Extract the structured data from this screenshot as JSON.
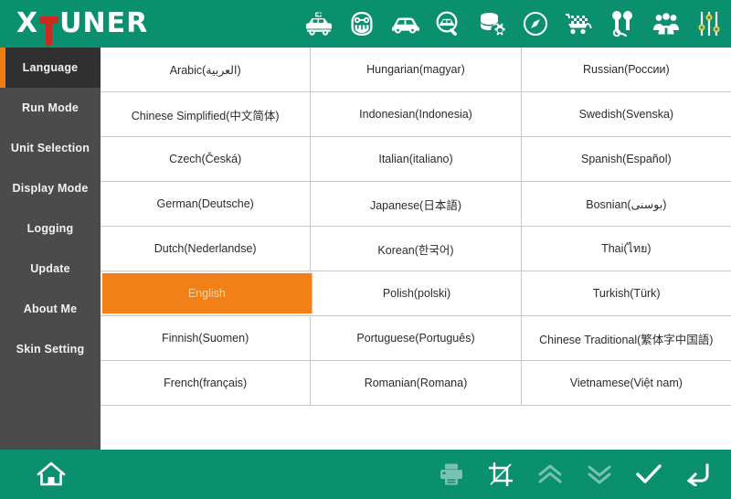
{
  "header": {
    "logo_x": "X",
    "logo_t": "T",
    "logo_rest": "UNER",
    "brand_color": "#0a8f6f",
    "accent_color": "#f28018",
    "logo_hammer_color": "#cc2a21",
    "toolbar_icons": [
      {
        "name": "ambulance-icon",
        "label": "Ambulance"
      },
      {
        "name": "diagnostic-face-icon",
        "label": "Technician"
      },
      {
        "name": "car-icon",
        "label": "Vehicle"
      },
      {
        "name": "car-search-icon",
        "label": "Vehicle Scan"
      },
      {
        "name": "database-settings-icon",
        "label": "Data Settings"
      },
      {
        "name": "compass-icon",
        "label": "Compass"
      },
      {
        "name": "shopping-cart-flag-icon",
        "label": "Shop"
      },
      {
        "name": "tools-icon",
        "label": "Tools"
      },
      {
        "name": "group-users-icon",
        "label": "Users"
      },
      {
        "name": "sliders-icon",
        "label": "Settings"
      }
    ]
  },
  "sidebar": {
    "items": [
      {
        "label": "Language",
        "active": true
      },
      {
        "label": "Run Mode",
        "active": false
      },
      {
        "label": "Unit Selection",
        "active": false
      },
      {
        "label": "Display Mode",
        "active": false
      },
      {
        "label": "Logging",
        "active": false
      },
      {
        "label": "Update",
        "active": false
      },
      {
        "label": "About Me",
        "active": false
      },
      {
        "label": "Skin Setting",
        "active": false
      }
    ]
  },
  "languages": {
    "selected": "English",
    "rows": [
      [
        "Arabic(العربية)",
        "Hungarian(magyar)",
        "Russian(России)"
      ],
      [
        "Chinese Simplified(中文简体)",
        "Indonesian(Indonesia)",
        "Swedish(Svenska)"
      ],
      [
        "Czech(Česká)",
        "Italian(italiano)",
        "Spanish(Español)"
      ],
      [
        "German(Deutsche)",
        "Japanese(日本語)",
        "Bosnian(بوسنی)"
      ],
      [
        "Dutch(Nederlandse)",
        "Korean(한국어)",
        "Thai(ไทย)"
      ],
      [
        "English",
        "Polish(polski)",
        "Turkish(Türk)"
      ],
      [
        "Finnish(Suomen)",
        "Portuguese(Português)",
        "Chinese Traditional(繁体字中国語)"
      ],
      [
        "French(français)",
        "Romanian(Romana)",
        "Vietnamese(Việt nam)"
      ]
    ]
  },
  "footer": {
    "home": {
      "name": "home-icon",
      "label": "Home"
    },
    "actions": [
      {
        "name": "print-icon",
        "label": "Print",
        "disabled": true
      },
      {
        "name": "screenshot-crop-icon",
        "label": "Screenshot",
        "disabled": false
      },
      {
        "name": "page-up-icon",
        "label": "Page Up",
        "disabled": true
      },
      {
        "name": "page-down-icon",
        "label": "Page Down",
        "disabled": true
      },
      {
        "name": "confirm-check-icon",
        "label": "Confirm",
        "disabled": false
      },
      {
        "name": "back-icon",
        "label": "Back",
        "disabled": false
      }
    ]
  }
}
